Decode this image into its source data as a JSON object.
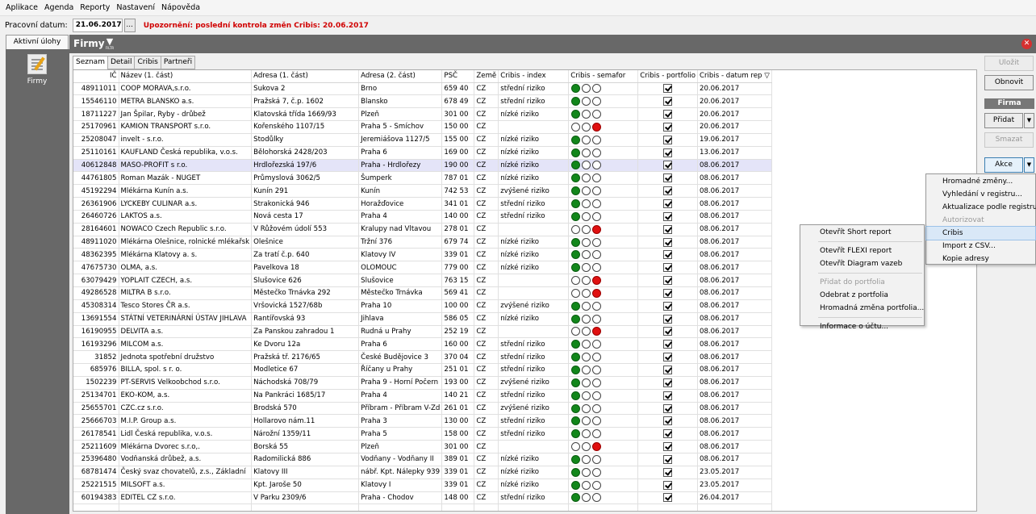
{
  "menubar": [
    "Aplikace",
    "Agenda",
    "Reporty",
    "Nastavení",
    "Nápověda"
  ],
  "datebar": {
    "label": "Pracovní datum:",
    "date": "21.06.2017",
    "picker": "...",
    "warning": "Upozornění: poslední kontrola změn Cribis: 20.06.2017"
  },
  "left": {
    "active_tab": "Aktivní úlohy",
    "module": "Firmy"
  },
  "header": {
    "title": "Firmy",
    "filter_label": "FILTR",
    "close_icon": "close-icon"
  },
  "tabs": [
    "Seznam",
    "Detail",
    "Cribis",
    "Partneři"
  ],
  "columns": [
    "IČ",
    "Název (1. část)",
    "Adresa (1. část)",
    "Adresa (2. část)",
    "PSČ",
    "Země",
    "Cribis - index",
    "Cribis - semafor",
    "Cribis - portfolio",
    "Cribis - datum rep"
  ],
  "sort_indicator": "▽",
  "rows": [
    {
      "ic": "48911011",
      "name": "COOP MORAVA,s.r.o.",
      "a1": "Sukova 2",
      "a2": "Brno",
      "psc": "659 40",
      "z": "CZ",
      "idx": "střední riziko",
      "sem": "g",
      "date": "20.06.2017"
    },
    {
      "ic": "15546110",
      "name": "METRA BLANSKO a.s.",
      "a1": "Pražská 7, č.p. 1602",
      "a2": "Blansko",
      "psc": "678 49",
      "z": "CZ",
      "idx": "střední riziko",
      "sem": "g",
      "date": "20.06.2017"
    },
    {
      "ic": "18711227",
      "name": "Jan Špilar, Ryby - drůbež",
      "a1": "Klatovská třída 1669/93",
      "a2": "Plzeň",
      "psc": "301 00",
      "z": "CZ",
      "idx": "nízké riziko",
      "sem": "g",
      "date": "20.06.2017"
    },
    {
      "ic": "25170961",
      "name": "KAMION TRANSPORT s.r.o.",
      "a1": "Kořenského 1107/15",
      "a2": "Praha 5 - Smíchov",
      "psc": "150 00",
      "z": "CZ",
      "idx": "",
      "sem": "r",
      "date": "20.06.2017"
    },
    {
      "ic": "25208047",
      "name": "invelt - s.r.o.",
      "a1": "Stodůlky",
      "a2": "Jeremiášova 1127/5",
      "psc": "155 00",
      "z": "CZ",
      "idx": "nízké riziko",
      "sem": "g",
      "date": "19.06.2017"
    },
    {
      "ic": "25110161",
      "name": "KAUFLAND Česká republika, v.o.s.",
      "a1": "Bělohorská 2428/203",
      "a2": "Praha 6",
      "psc": "169 00",
      "z": "CZ",
      "idx": "nízké riziko",
      "sem": "g",
      "date": "13.06.2017"
    },
    {
      "ic": "40612848",
      "name": "MASO-PROFIT s r.o.",
      "a1": "Hrdlořezská 197/6",
      "a2": "Praha - Hrdlořezy",
      "psc": "190 00",
      "z": "CZ",
      "idx": "nízké riziko",
      "sem": "g",
      "date": "08.06.2017",
      "sel": true
    },
    {
      "ic": "44761805",
      "name": "Roman Mazák - NUGET",
      "a1": "Průmyslová 3062/5",
      "a2": "Šumperk",
      "psc": "787 01",
      "z": "CZ",
      "idx": "nízké riziko",
      "sem": "g",
      "date": "08.06.2017"
    },
    {
      "ic": "45192294",
      "name": "Mlékárna Kunín a.s.",
      "a1": "Kunín 291",
      "a2": "Kunín",
      "psc": "742 53",
      "z": "CZ",
      "idx": "zvýšené riziko",
      "sem": "g",
      "date": "08.06.2017"
    },
    {
      "ic": "26361906",
      "name": "LYCKEBY CULINAR a.s.",
      "a1": "Strakonická 946",
      "a2": "Horažďovice",
      "psc": "341 01",
      "z": "CZ",
      "idx": "střední riziko",
      "sem": "g",
      "date": "08.06.2017"
    },
    {
      "ic": "26460726",
      "name": "LAKTOS a.s.",
      "a1": "Nová cesta 17",
      "a2": "Praha 4",
      "psc": "140 00",
      "z": "CZ",
      "idx": "střední riziko",
      "sem": "g",
      "date": "08.06.2017"
    },
    {
      "ic": "28164601",
      "name": "NOWACO Czech Republic s.r.o.",
      "a1": "V Růžovém údolí 553",
      "a2": "Kralupy nad Vltavou",
      "psc": "278 01",
      "z": "CZ",
      "idx": "",
      "sem": "r",
      "date": "08.06.2017"
    },
    {
      "ic": "48911020",
      "name": "Mlékárna Olešnice, rolnické mlékařsk",
      "a1": "Olešnice",
      "a2": "Tržní 376",
      "psc": "679 74",
      "z": "CZ",
      "idx": "nízké riziko",
      "sem": "g",
      "date": "08.06.2017"
    },
    {
      "ic": "48362395",
      "name": "Mlékárna Klatovy a. s.",
      "a1": "Za tratí č.p. 640",
      "a2": "Klatovy IV",
      "psc": "339 01",
      "z": "CZ",
      "idx": "nízké riziko",
      "sem": "g",
      "date": "08.06.2017"
    },
    {
      "ic": "47675730",
      "name": "OLMA, a.s.",
      "a1": "Pavelkova 18",
      "a2": "OLOMOUC",
      "psc": "779 00",
      "z": "CZ",
      "idx": "nízké riziko",
      "sem": "g",
      "date": "08.06.2017"
    },
    {
      "ic": "63079429",
      "name": "YOPLAIT CZECH, a.s.",
      "a1": "Slušovice 626",
      "a2": "Slušovice",
      "psc": "763 15",
      "z": "CZ",
      "idx": "",
      "sem": "r",
      "date": "08.06.2017"
    },
    {
      "ic": "49286528",
      "name": "MILTRA B s.r.o.",
      "a1": "Městečko Trnávka 292",
      "a2": "Městečko Trnávka",
      "psc": "569 41",
      "z": "CZ",
      "idx": "",
      "sem": "r",
      "date": "08.06.2017"
    },
    {
      "ic": "45308314",
      "name": "Tesco Stores ČR a.s.",
      "a1": "Vršovická 1527/68b",
      "a2": "Praha 10",
      "psc": "100 00",
      "z": "CZ",
      "idx": "zvýšené riziko",
      "sem": "g",
      "date": "08.06.2017"
    },
    {
      "ic": "13691554",
      "name": "STÁTNÍ VETERINÁRNÍ ÚSTAV JIHLAVA",
      "a1": "Rantířovská 93",
      "a2": "Jihlava",
      "psc": "586 05",
      "z": "CZ",
      "idx": "nízké riziko",
      "sem": "g",
      "date": "08.06.2017"
    },
    {
      "ic": "16190955",
      "name": "DELVITA a.s.",
      "a1": "Za Panskou zahradou 1",
      "a2": "Rudná u Prahy",
      "psc": "252 19",
      "z": "CZ",
      "idx": "",
      "sem": "r",
      "date": "08.06.2017"
    },
    {
      "ic": "16193296",
      "name": "MILCOM a.s.",
      "a1": "Ke Dvoru 12a",
      "a2": "Praha 6",
      "psc": "160 00",
      "z": "CZ",
      "idx": "střední riziko",
      "sem": "g",
      "date": "08.06.2017"
    },
    {
      "ic": "31852",
      "name": "Jednota spotřební družstvo",
      "a1": "Pražská tř. 2176/65",
      "a2": "České Budějovice 3",
      "psc": "370 04",
      "z": "CZ",
      "idx": "střední riziko",
      "sem": "g",
      "date": "08.06.2017"
    },
    {
      "ic": "685976",
      "name": "BILLA, spol. s r. o.",
      "a1": "Modletice 67",
      "a2": "Říčany u Prahy",
      "psc": "251 01",
      "z": "CZ",
      "idx": "střední riziko",
      "sem": "g",
      "date": "08.06.2017"
    },
    {
      "ic": "1502239",
      "name": "PT-SERVIS Velkoobchod s.r.o.",
      "a1": "Náchodská 708/79",
      "a2": "Praha 9 - Horní Počern",
      "psc": "193 00",
      "z": "CZ",
      "idx": "zvýšené riziko",
      "sem": "g",
      "date": "08.06.2017"
    },
    {
      "ic": "25134701",
      "name": "EKO-KOM, a.s.",
      "a1": "Na Pankráci 1685/17",
      "a2": "Praha 4",
      "psc": "140 21",
      "z": "CZ",
      "idx": "střední riziko",
      "sem": "g",
      "date": "08.06.2017"
    },
    {
      "ic": "25655701",
      "name": "CZC.cz s.r.o.",
      "a1": "Brodská 570",
      "a2": "Příbram - Příbram V-Zd",
      "psc": "261 01",
      "z": "CZ",
      "idx": "zvýšené riziko",
      "sem": "g",
      "date": "08.06.2017"
    },
    {
      "ic": "25666703",
      "name": "M.I.P. Group a.s.",
      "a1": "Hollarovo nám.11",
      "a2": "Praha 3",
      "psc": "130 00",
      "z": "CZ",
      "idx": "střední riziko",
      "sem": "g",
      "date": "08.06.2017"
    },
    {
      "ic": "26178541",
      "name": "Lidl Česká republika, v.o.s.",
      "a1": "Nárožní 1359/11",
      "a2": "Praha 5",
      "psc": "158 00",
      "z": "CZ",
      "idx": "střední riziko",
      "sem": "g",
      "date": "08.06.2017"
    },
    {
      "ic": "25211609",
      "name": "Mlékárna Dvorec s.r.o,.",
      "a1": "Borská 55",
      "a2": "Plzeň",
      "psc": "301 00",
      "z": "CZ",
      "idx": "",
      "sem": "r",
      "date": "08.06.2017"
    },
    {
      "ic": "25396480",
      "name": "Vodňanská drůbež, a.s.",
      "a1": "Radomilická 886",
      "a2": "Vodňany - Vodňany II",
      "psc": "389 01",
      "z": "CZ",
      "idx": "nízké riziko",
      "sem": "g",
      "date": "08.06.2017"
    },
    {
      "ic": "68781474",
      "name": "Český svaz chovatelů, z.s., Základní",
      "a1": "Klatovy III",
      "a2": "nábř. Kpt. Nálepky 939",
      "psc": "339 01",
      "z": "CZ",
      "idx": "nízké riziko",
      "sem": "g",
      "date": "23.05.2017"
    },
    {
      "ic": "25221515",
      "name": "MILSOFT a.s.",
      "a1": "Kpt. Jaroše 50",
      "a2": "Klatovy I",
      "psc": "339 01",
      "z": "CZ",
      "idx": "nízké riziko",
      "sem": "g",
      "date": "23.05.2017"
    },
    {
      "ic": "60194383",
      "name": "EDITEL CZ s.r.o.",
      "a1": "V Parku 2309/6",
      "a2": "Praha - Chodov",
      "psc": "148 00",
      "z": "CZ",
      "idx": "střední riziko",
      "sem": "g",
      "date": "26.04.2017"
    }
  ],
  "right": {
    "save": "Uložit",
    "refresh": "Obnovit",
    "section": "Firma",
    "add": "Přidat",
    "delete": "Smazat",
    "actions": "Akce"
  },
  "akce_menu": [
    {
      "label": "Hromadné změny...",
      "dis": false
    },
    {
      "label": "Vyhledání v registru...",
      "dis": false
    },
    {
      "label": "Aktualizace podle registru...",
      "dis": false
    },
    {
      "label": "Autorizovat",
      "dis": true
    },
    {
      "label": "Cribis",
      "dis": false,
      "hl": true
    },
    {
      "label": "Import z CSV...",
      "dis": false
    },
    {
      "label": "Kopie adresy",
      "dis": false
    }
  ],
  "cribis_menu": [
    {
      "label": "Otevřít Short report",
      "dis": false
    },
    {
      "sep": true
    },
    {
      "label": "Otevřít FLEXI report",
      "dis": false
    },
    {
      "label": "Otevřít Diagram vazeb",
      "dis": false
    },
    {
      "sep": true
    },
    {
      "label": "Přidat do portfolia",
      "dis": true
    },
    {
      "label": "Odebrat z portfolia",
      "dis": false
    },
    {
      "label": "Hromadná změna portfolia...",
      "dis": false
    },
    {
      "sep": true
    },
    {
      "label": "Informace o účtu...",
      "dis": false
    }
  ],
  "colors": {
    "dark_panel": "#686868",
    "warning": "#d00000",
    "green": "#12871b",
    "red": "#e01010",
    "selected_row": "#e4e4f8"
  }
}
